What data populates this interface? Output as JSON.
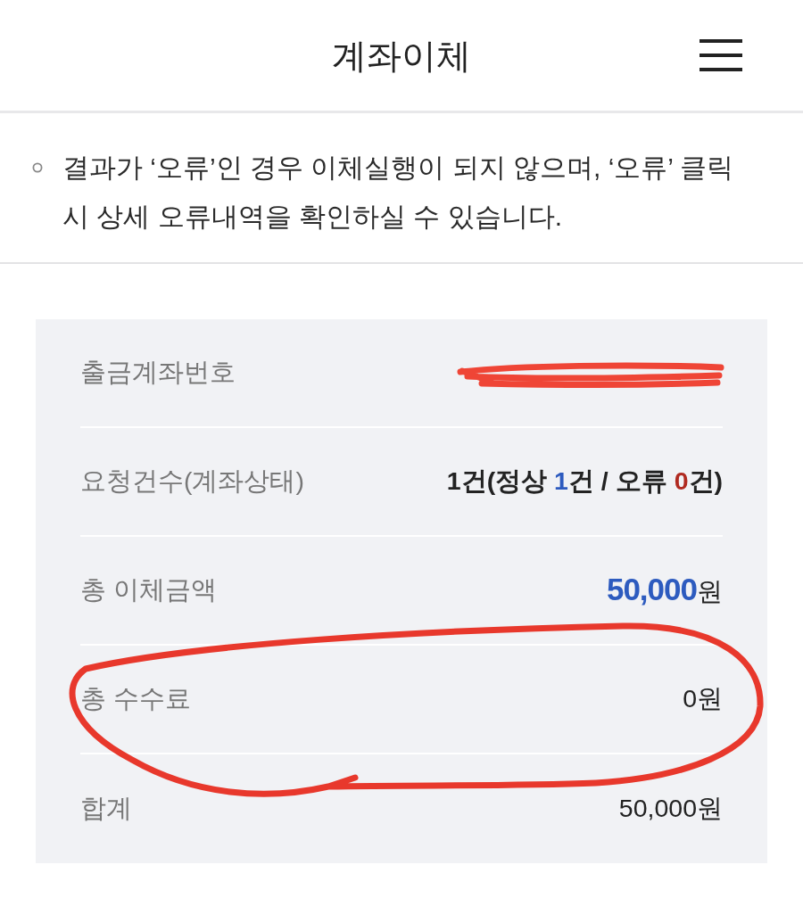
{
  "header": {
    "title": "계좌이체"
  },
  "notice": {
    "text": "결과가 ‘오류’인 경우 이체실행이 되지 않으며, ‘오류’ 클릭 시 상세 오류내역을 확인하실 수 있습니다."
  },
  "summary": {
    "rows": [
      {
        "label": "출금계좌번호",
        "redacted": true,
        "circled": false
      },
      {
        "label": "요청건수(계좌상태)",
        "value": [
          {
            "text": "1건(정상 ",
            "kind": "strong"
          },
          {
            "text": "1",
            "kind": "normal_count"
          },
          {
            "text": "건 / 오류 ",
            "kind": "strong"
          },
          {
            "text": "0",
            "kind": "error_count"
          },
          {
            "text": "건)",
            "kind": "strong"
          }
        ],
        "redacted": false,
        "circled": false
      },
      {
        "label": "총 이체금액",
        "value": [
          {
            "text": "50,000",
            "kind": "amount"
          },
          {
            "text": "원",
            "kind": "plain"
          }
        ],
        "redacted": false,
        "circled": false
      },
      {
        "label": "총 수수료",
        "value": [
          {
            "text": "0원",
            "kind": "plain"
          }
        ],
        "redacted": false,
        "circled": true
      },
      {
        "label": "합계",
        "value": [
          {
            "text": "50,000원",
            "kind": "plain"
          }
        ],
        "redacted": false,
        "circled": false
      }
    ]
  }
}
